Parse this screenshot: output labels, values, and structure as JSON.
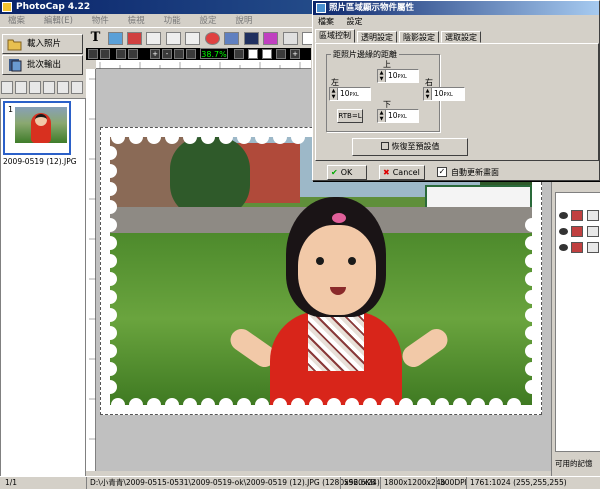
{
  "window": {
    "title": "PhotoCap 4.22"
  },
  "menu": [
    "檔案",
    "編輯(E)",
    "物件",
    "檢視",
    "功能",
    "設定",
    "說明"
  ],
  "left": {
    "load_button": "載入照片",
    "batch_button": "批次輸出",
    "thumbnail": {
      "index": "1",
      "filename": "2009-0519 (12).JPG"
    }
  },
  "toolbar1": {
    "items": [
      "text-tool",
      "image-tool",
      "color-tool",
      "img-tool",
      "frame-tool",
      "text-frame-tool",
      "clock-tool",
      "grid-tool",
      "font-tool",
      "paint-tool",
      "table-tool",
      "speech-tool"
    ]
  },
  "toolbar2": {
    "zoom": "38.7%"
  },
  "dialog": {
    "title": "照片區域顯示物件屬性",
    "menu": [
      "檔案",
      "設定"
    ],
    "tabs": [
      "區域控制",
      "透明設定",
      "陰影設定",
      "選取設定"
    ],
    "active_tab": "區域控制",
    "group_label": "距照片邊緣的距離",
    "labels": {
      "top": "上",
      "left": "左",
      "right": "右",
      "bottom": "下"
    },
    "values": {
      "top": "10",
      "left": "10",
      "right": "10",
      "bottom": "10"
    },
    "unit": "PXL",
    "rtbl_button": "RTB=L",
    "reset_button": "恢復至預設值",
    "ok_button": "OK",
    "cancel_button": "Cancel",
    "auto_refresh_label": "自動更新畫面",
    "auto_refresh_checked": true
  },
  "right_panel": {
    "footer": "可用的記憶"
  },
  "status": {
    "page": "1/1",
    "path": "D:\\小青青\\2009-0515-0531\\2009-0519-ok\\2009-0519 (12).JPG (1280x960x24)",
    "size": "552.6KB",
    "dims": "1800x1200x24b",
    "dpi": "300DPI",
    "coords": "1761:1024 (255,255,255)"
  },
  "colors": {
    "title_bar": "#0a246a",
    "canvas_bg": "#c0c0c0",
    "accent": "#2b60c8"
  }
}
